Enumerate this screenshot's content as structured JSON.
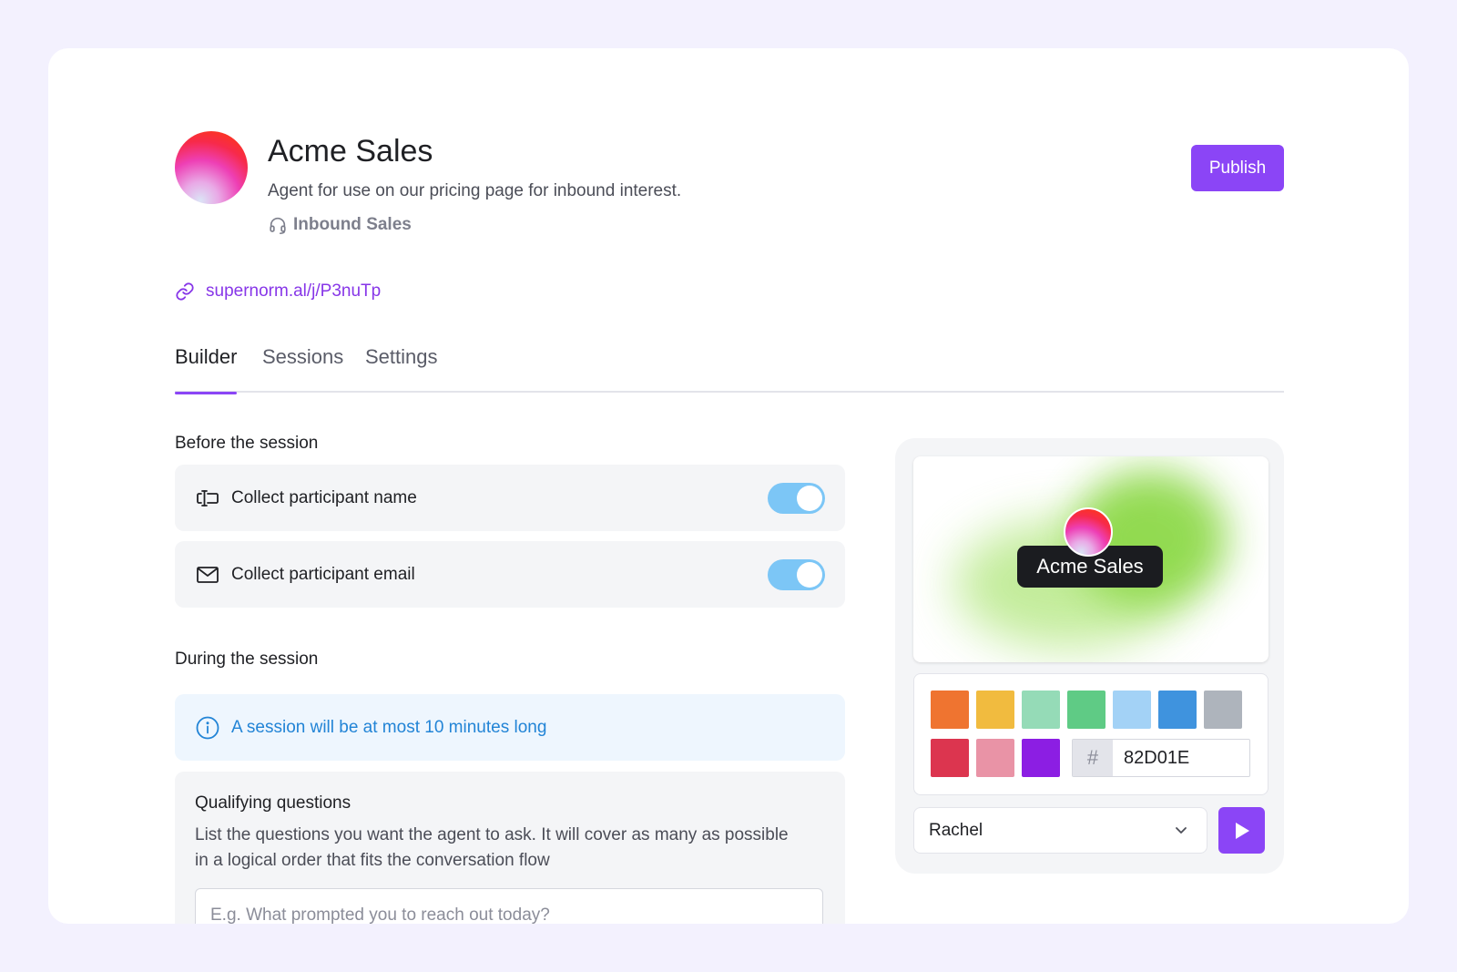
{
  "agent": {
    "name": "Acme Sales",
    "description": "Agent for use on our pricing page for inbound interest.",
    "category": "Inbound Sales",
    "category_icon": "headset-icon",
    "link": "supernorm.al/j/P3nuTp"
  },
  "actions": {
    "publish_label": "Publish"
  },
  "tabs": [
    {
      "label": "Builder",
      "active": true
    },
    {
      "label": "Sessions",
      "active": false
    },
    {
      "label": "Settings",
      "active": false
    }
  ],
  "before_session": {
    "title": "Before the session",
    "items": [
      {
        "label": "Collect participant name",
        "icon": "text-cursor-icon",
        "enabled": true
      },
      {
        "label": "Collect participant email",
        "icon": "envelope-icon",
        "enabled": true
      }
    ]
  },
  "during_session": {
    "title": "During the session",
    "info": "A session will be at most 10 minutes long"
  },
  "qualifying": {
    "title": "Qualifying questions",
    "description": "List the questions you want the agent to ask. It will cover as many as possible in a logical order that fits the conversation flow",
    "placeholder": "E.g. What prompted you to reach out today?"
  },
  "preview": {
    "name": "Acme Sales",
    "swatches": [
      "#ef7430",
      "#f1bb3f",
      "#95dbb7",
      "#5fcb85",
      "#a3d2f6",
      "#3f93de",
      "#aeb4bc",
      "#dc354f",
      "#e993a6",
      "#8c1ee3"
    ],
    "hex_prefix": "#",
    "hex_value": "82D01E",
    "voice": "Rachel"
  },
  "colors": {
    "accent": "#8b45f6",
    "link": "#8736e8",
    "toggle_on": "#7cc6f6",
    "info_text": "#2284d6",
    "info_bg": "#eef6fe"
  }
}
